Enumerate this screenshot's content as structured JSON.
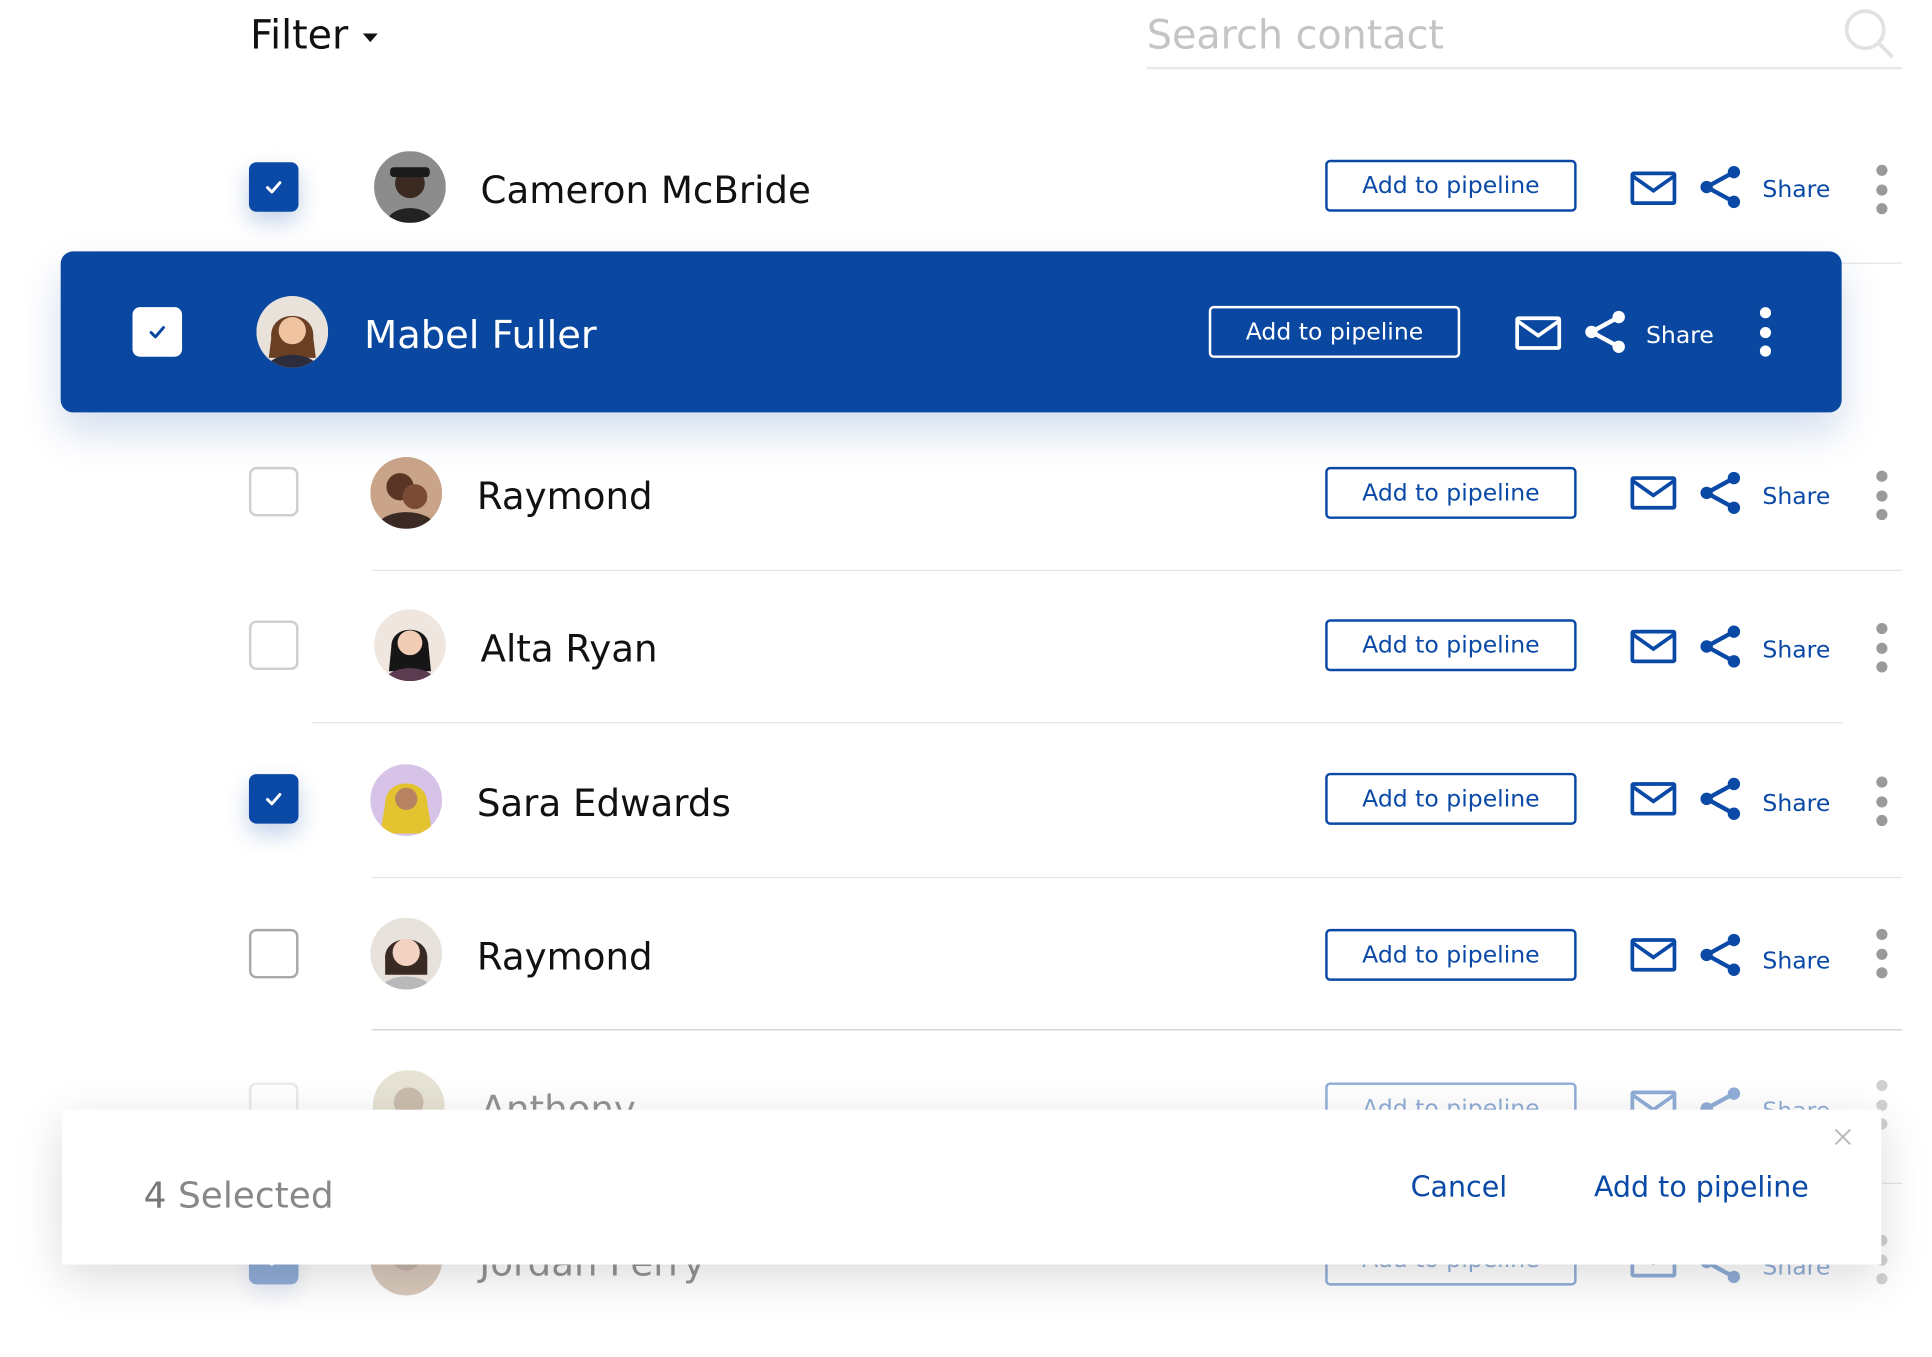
{
  "header": {
    "filter_label": "Filter",
    "search_placeholder": "Search contact"
  },
  "contacts": [
    {
      "name": "Cameron McBride",
      "checked": true,
      "add_label": "Add to pipeline",
      "share_label": "Share"
    },
    {
      "name": "Mabel Fuller",
      "checked": true,
      "add_label": "Add to pipeline",
      "share_label": "Share",
      "highlighted": true
    },
    {
      "name": "Raymond",
      "checked": false,
      "add_label": "Add to pipeline",
      "share_label": "Share"
    },
    {
      "name": "Alta Ryan",
      "checked": false,
      "add_label": "Add to pipeline",
      "share_label": "Share"
    },
    {
      "name": "Sara Edwards",
      "checked": true,
      "add_label": "Add to pipeline",
      "share_label": "Share"
    },
    {
      "name": "Raymond",
      "checked": false,
      "add_label": "Add to pipeline",
      "share_label": "Share"
    },
    {
      "name": "Anthony",
      "checked": false,
      "add_label": "Add to pipeline",
      "share_label": "Share"
    },
    {
      "name": "Jordan Perry",
      "checked": true,
      "add_label": "Add to pipeline",
      "share_label": "Share"
    }
  ],
  "toast": {
    "count": "4",
    "selected_label": "Selected",
    "cancel_label": "Cancel",
    "add_label": "Add to pipeline"
  },
  "colors": {
    "accent": "#0a4aa6",
    "highlight_row": "#0a47a0"
  },
  "icons": [
    "search-icon",
    "chevron-down-icon",
    "check-icon",
    "mail-icon",
    "share-icon",
    "more-vertical-icon",
    "close-icon"
  ]
}
